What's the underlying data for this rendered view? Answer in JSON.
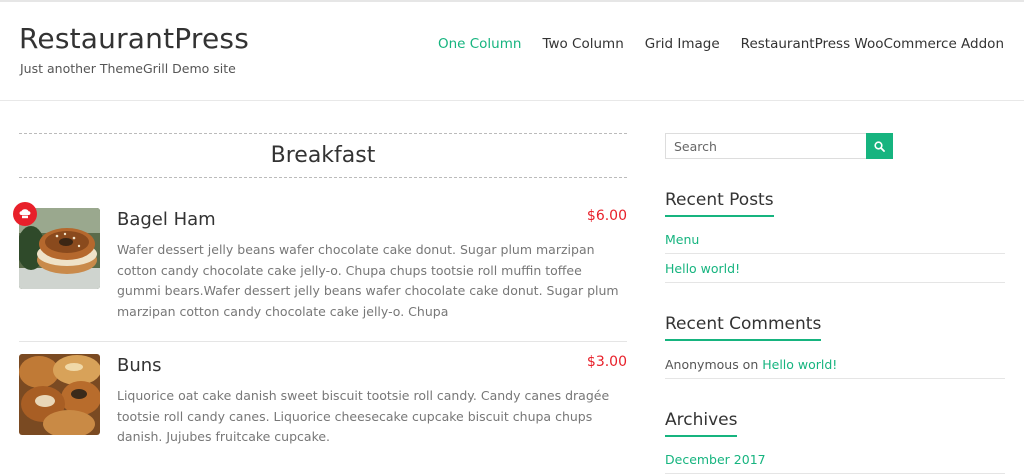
{
  "site": {
    "title": "RestaurantPress",
    "description": "Just another ThemeGrill Demo site"
  },
  "nav": {
    "items": [
      {
        "label": "One Column",
        "active": true
      },
      {
        "label": "Two Column",
        "active": false
      },
      {
        "label": "Grid Image",
        "active": false
      },
      {
        "label": "RestaurantPress WooCommerce Addon",
        "active": false
      }
    ]
  },
  "menu": {
    "category": "Breakfast",
    "items": [
      {
        "title": "Bagel Ham",
        "price": "$6.00",
        "description": "Wafer dessert jelly beans wafer chocolate cake donut. Sugar plum marzipan cotton candy chocolate cake jelly-o. Chupa chups tootsie roll muffin toffee gummi bears.Wafer dessert jelly beans wafer chocolate cake donut. Sugar plum marzipan cotton candy chocolate cake jelly-o. Chupa",
        "badge_icon": "chef-hat-icon"
      },
      {
        "title": "Buns",
        "price": "$3.00",
        "description": "Liquorice oat cake danish sweet biscuit tootsie roll candy. Candy canes dragée tootsie roll candy canes. Liquorice cheesecake cupcake biscuit chupa chups danish. Jujubes fruitcake cupcake."
      }
    ]
  },
  "sidebar": {
    "search": {
      "placeholder": "Search",
      "button_icon": "search-icon"
    },
    "recent_posts": {
      "title": "Recent Posts",
      "items": [
        "Menu",
        "Hello world!"
      ]
    },
    "recent_comments": {
      "title": "Recent Comments",
      "items": [
        {
          "author": "Anonymous",
          "connector": " on ",
          "post": "Hello world!"
        }
      ]
    },
    "archives": {
      "title": "Archives",
      "items": [
        "December 2017"
      ]
    }
  },
  "colors": {
    "accent": "#16b47f",
    "price": "#e8202a",
    "badge": "#e8202a"
  }
}
